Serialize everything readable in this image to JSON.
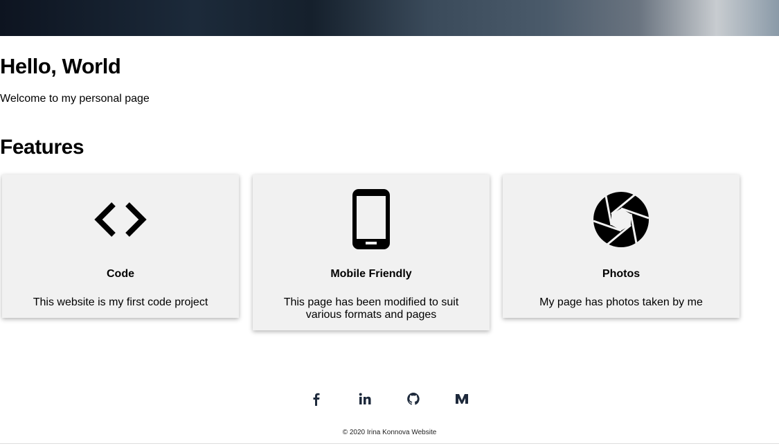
{
  "header": {
    "title": "Hello, World",
    "subtitle": "Welcome to my personal page"
  },
  "features": {
    "heading": "Features",
    "items": [
      {
        "icon": "code-icon",
        "title": "Code",
        "desc": "This website is my first code project"
      },
      {
        "icon": "mobile-icon",
        "title": "Mobile Friendly",
        "desc": "This page has been modified to suit various formats and pages"
      },
      {
        "icon": "camera-aperture-icon",
        "title": "Photos",
        "desc": "My page has photos taken by me"
      }
    ]
  },
  "footer": {
    "social": [
      "facebook-icon",
      "linkedin-icon",
      "github-icon",
      "medium-icon"
    ],
    "copyright": "© 2020 Irina Konnova Website"
  }
}
